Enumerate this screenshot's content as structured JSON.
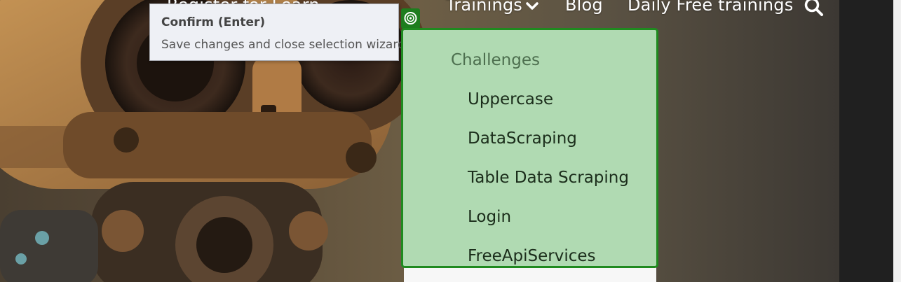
{
  "nav": {
    "hidden_item": "Register for Learn",
    "trainings": "Trainings",
    "blog": "Blog",
    "daily": "Daily Free trainings"
  },
  "tooltip": {
    "title": "Confirm (Enter)",
    "description": "Save changes and close selection wizard."
  },
  "dropdown": {
    "header": "Challenges",
    "items": [
      "Uppercase",
      "DataScraping",
      "Table Data Scraping",
      "Login",
      "FreeApiServices"
    ]
  },
  "colors": {
    "dropdown_bg": "#b0dab2",
    "dropdown_border": "#1f8a1f",
    "tooltip_bg": "#eef0f5",
    "target_marker": "#1e7d1e"
  },
  "icons": {
    "search": "search-icon",
    "chevron": "chevron-down-icon",
    "target": "target-icon"
  }
}
